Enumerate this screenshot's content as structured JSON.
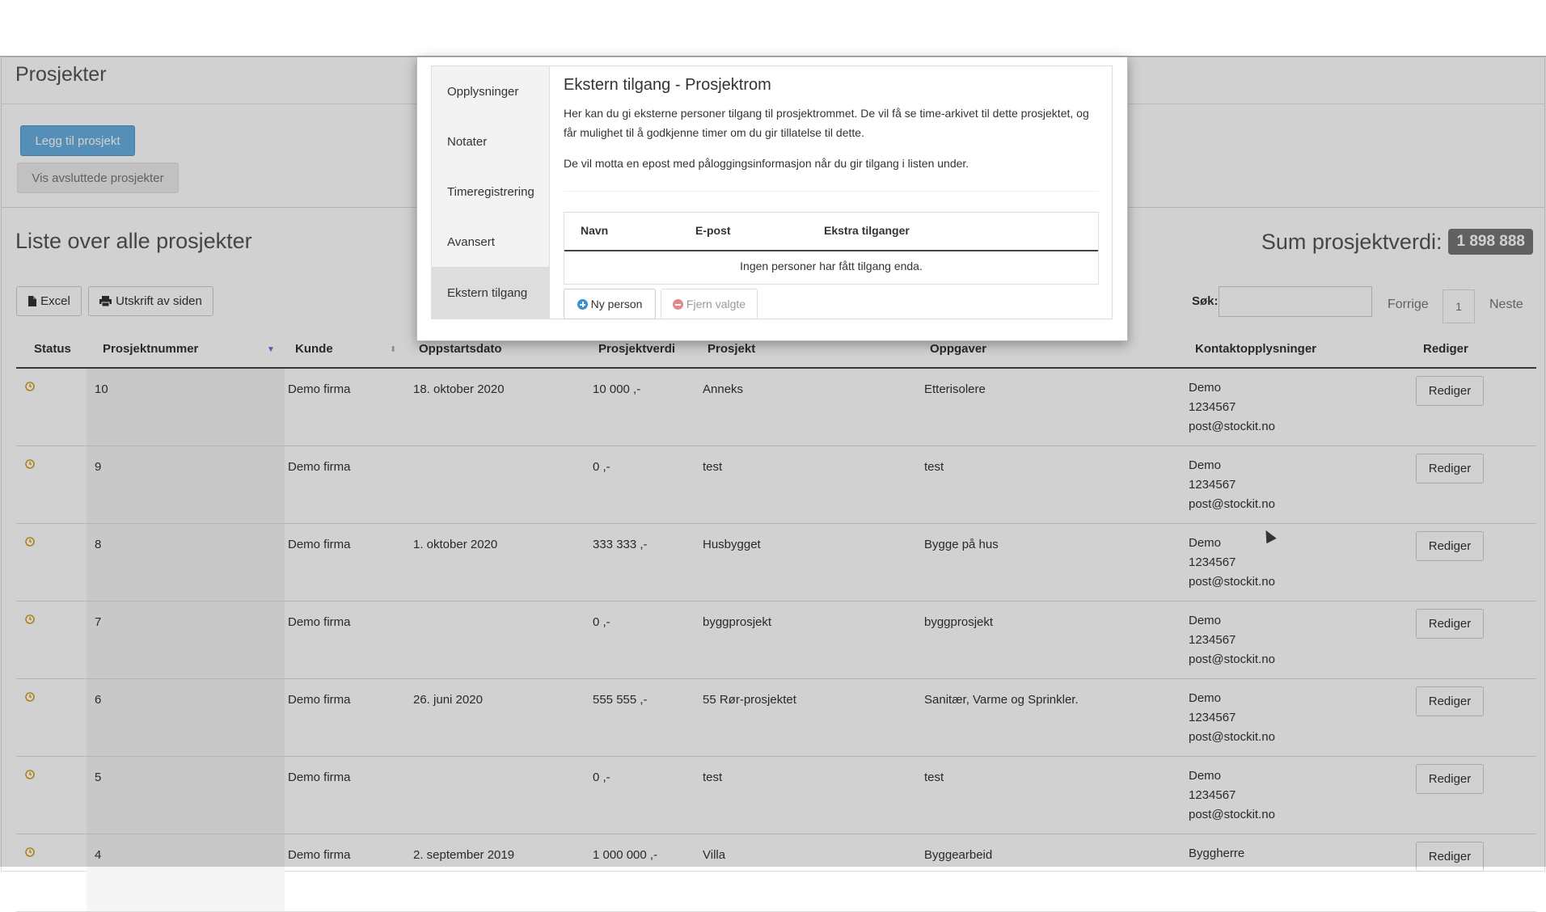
{
  "page": {
    "title": "Prosjekter",
    "add_button": "Legg til prosjekt",
    "show_closed_button": "Vis avsluttede prosjekter"
  },
  "list": {
    "title": "Liste over alle prosjekter",
    "sum_label": "Sum prosjektverdi:",
    "sum_value": "1 898 888",
    "excel_button": "Excel",
    "print_button": "Utskrift av siden",
    "search_label": "Søk:",
    "search_value": "",
    "pagination": {
      "prev": "Forrige",
      "current": "1",
      "next": "Neste"
    },
    "columns": [
      "Status",
      "Prosjektnummer",
      "Kunde",
      "Oppstartsdato",
      "Prosjektverdi",
      "Prosjekt",
      "Oppgaver",
      "Kontaktopplysninger",
      "Rediger"
    ],
    "rows": [
      {
        "nr": "10",
        "kunde": "Demo firma",
        "dato": "18. oktober 2020",
        "verdi": "10 000 ,-",
        "prosjekt": "Anneks",
        "oppgaver": "Etterisolere",
        "kontakt_navn": "Demo",
        "kontakt_tlf": "1234567",
        "kontakt_epost": "post@stockit.no",
        "edit": "Rediger"
      },
      {
        "nr": "9",
        "kunde": "Demo firma",
        "dato": "",
        "verdi": "0 ,-",
        "prosjekt": "test",
        "oppgaver": "test",
        "kontakt_navn": "Demo",
        "kontakt_tlf": "1234567",
        "kontakt_epost": "post@stockit.no",
        "edit": "Rediger"
      },
      {
        "nr": "8",
        "kunde": "Demo firma",
        "dato": "1. oktober 2020",
        "verdi": "333 333 ,-",
        "prosjekt": "Husbygget",
        "oppgaver": "Bygge på hus",
        "kontakt_navn": "Demo",
        "kontakt_tlf": "1234567",
        "kontakt_epost": "post@stockit.no",
        "edit": "Rediger"
      },
      {
        "nr": "7",
        "kunde": "Demo firma",
        "dato": "",
        "verdi": "0 ,-",
        "prosjekt": "byggprosjekt",
        "oppgaver": "byggprosjekt",
        "kontakt_navn": "Demo",
        "kontakt_tlf": "1234567",
        "kontakt_epost": "post@stockit.no",
        "edit": "Rediger"
      },
      {
        "nr": "6",
        "kunde": "Demo firma",
        "dato": "26. juni 2020",
        "verdi": "555 555 ,-",
        "prosjekt": "55 Rør-prosjektet",
        "oppgaver": "Sanitær, Varme og Sprinkler.",
        "kontakt_navn": "Demo",
        "kontakt_tlf": "1234567",
        "kontakt_epost": "post@stockit.no",
        "edit": "Rediger"
      },
      {
        "nr": "5",
        "kunde": "Demo firma",
        "dato": "",
        "verdi": "0 ,-",
        "prosjekt": "test",
        "oppgaver": "test",
        "kontakt_navn": "Demo",
        "kontakt_tlf": "1234567",
        "kontakt_epost": "post@stockit.no",
        "edit": "Rediger"
      },
      {
        "nr": "4",
        "kunde": "Demo firma",
        "dato": "2. september 2019",
        "verdi": "1 000 000 ,-",
        "prosjekt": "Villa",
        "oppgaver": "Byggearbeid",
        "kontakt_navn": "Byggherre",
        "kontakt_tlf": "",
        "kontakt_epost": "",
        "edit": "Rediger"
      }
    ]
  },
  "modal": {
    "nav": [
      "Opplysninger",
      "Notater",
      "Timeregistrering",
      "Avansert",
      "Ekstern tilgang"
    ],
    "active_nav": "Ekstern tilgang",
    "title": "Ekstern tilgang - Prosjektrom",
    "paragraph1": "Her kan du gi eksterne personer tilgang til prosjektrommet. De vil få se time-arkivet til dette prosjektet, og får mulighet til å godkjenne timer om du gir tillatelse til dette.",
    "paragraph2": "De vil motta en epost med påloggingsinformasjon når du gir tilgang i listen under.",
    "table_headers": [
      "Navn",
      "E-post",
      "Ekstra tilganger"
    ],
    "empty_text": "Ingen personer har fått tilgang enda.",
    "new_person_button": "Ny person",
    "remove_button": "Fjern valgte"
  },
  "colors": {
    "primary": "#68aee0",
    "badge": "#777777",
    "status_icon": "#d4a017"
  },
  "icons": {
    "excel": "file-icon",
    "print": "printer-icon",
    "status": "clock-icon",
    "new_person": "plus-circle-icon",
    "remove": "minus-circle-icon"
  }
}
